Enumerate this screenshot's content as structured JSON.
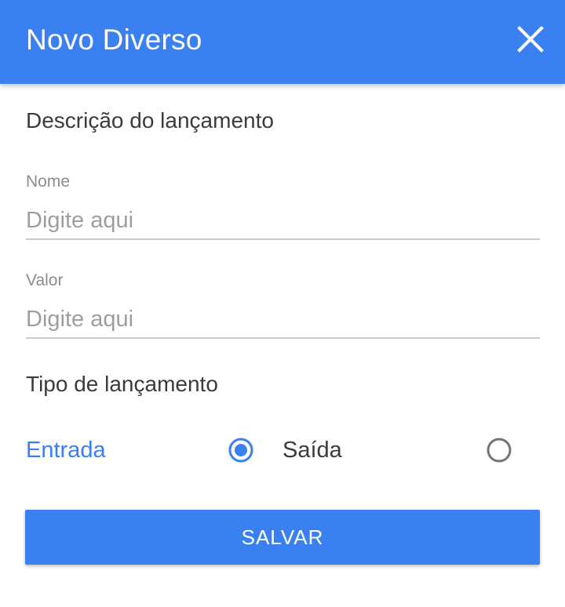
{
  "header": {
    "title": "Novo Diverso",
    "close_icon": "close-icon",
    "background_color": "#3b80f0"
  },
  "description_section": {
    "title": "Descrição do lançamento",
    "fields": [
      {
        "label": "Nome",
        "value": "",
        "placeholder": "Digite aqui"
      },
      {
        "label": "Valor",
        "value": "",
        "placeholder": "Digite aqui"
      }
    ]
  },
  "type_section": {
    "title": "Tipo de lançamento",
    "options": [
      {
        "label": "Entrada",
        "selected": true
      },
      {
        "label": "Saída",
        "selected": false
      }
    ]
  },
  "actions": {
    "save_label": "SALVAR"
  },
  "colors": {
    "accent": "#3b80f0",
    "radio_unselected": "#757575"
  }
}
